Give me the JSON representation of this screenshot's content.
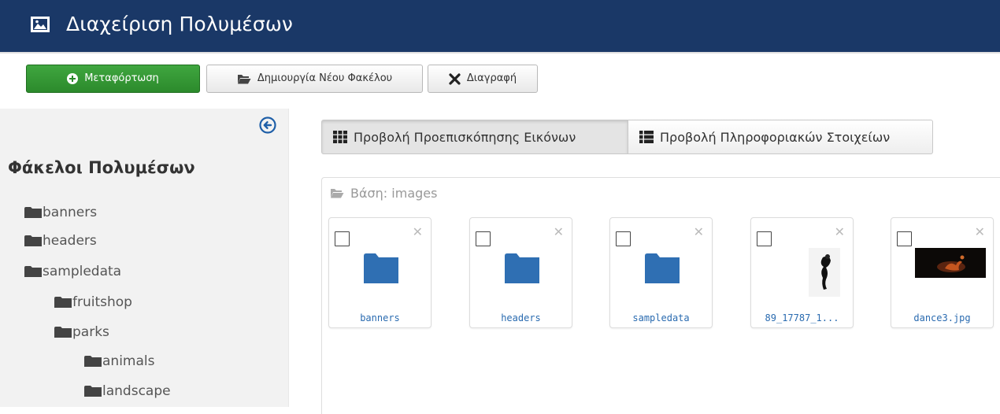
{
  "header": {
    "title": "Διαχείριση Πολυμέσων",
    "icon": "image-icon",
    "background": "#1a3867"
  },
  "toolbar": {
    "upload_label": "Μεταφόρτωση",
    "new_folder_label": "Δημιουργία Νέου Φακέλου",
    "delete_label": "Διαγραφή",
    "upload_color": "#2f9530"
  },
  "sidebar": {
    "title": "Φάκελοι Πολυμέσων",
    "items": [
      {
        "label": "banners",
        "depth": 0
      },
      {
        "label": "headers",
        "depth": 0
      },
      {
        "label": "sampledata",
        "depth": 0
      },
      {
        "label": "fruitshop",
        "depth": 1
      },
      {
        "label": "parks",
        "depth": 1
      },
      {
        "label": "animals",
        "depth": 2
      },
      {
        "label": "landscape",
        "depth": 2
      }
    ]
  },
  "main": {
    "view_thumbs_label": "Προβολή Προεπισκόπησης Εικόνων",
    "view_details_label": "Προβολή Πληροφοριακών Στοιχείων",
    "base_path": "Βάση: images",
    "items": [
      {
        "label": "banners",
        "type": "folder"
      },
      {
        "label": "headers",
        "type": "folder"
      },
      {
        "label": "sampledata",
        "type": "folder"
      },
      {
        "label": "89_17787_1...",
        "type": "image"
      },
      {
        "label": "dance3.jpg",
        "type": "image"
      }
    ],
    "link_color": "#2a6bb0",
    "folder_color": "#2f6fb3"
  }
}
